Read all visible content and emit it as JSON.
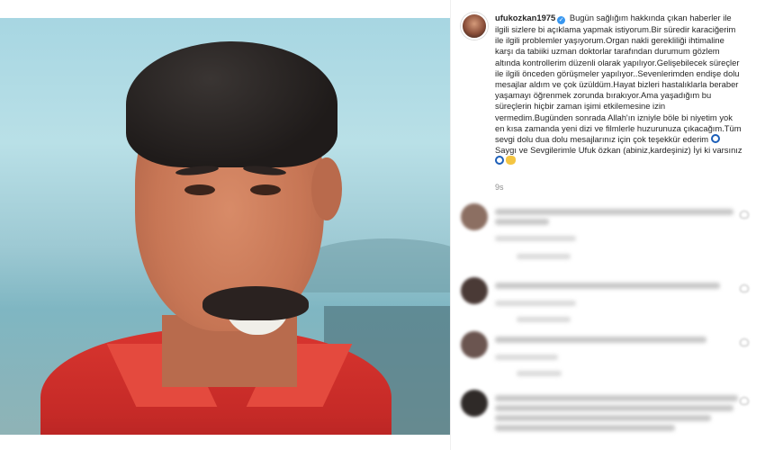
{
  "post": {
    "username": "ufukozkan1975",
    "caption_body": " Bugün sağlığım hakkında çıkan haberler ile\nilgili sizlere bi açıklama yapmak istiyorum.Bir süredir karaciğerim\nile ilgili problemler yaşıyorum.Organ nakli gerekliliği ihtimaline\nkarşı da tabiiki uzman doktorlar tarafından durumum gözlem\naltında kontrollerim düzenli olarak yapılıyor.Gelişebilecek süreçler\nile ilgili önceden görüşmeler yapılıyor..Sevenlerimden endişe dolu\nmesajlar aldım ve çok üzüldüm.Hayat bizleri hastalıklarla beraber\nyaşamayı öğrenmek zorunda bırakıyor.Ama yaşadığım bu\nsüreçlerin hiçbir zaman işimi etkilemesine izin\nvermedim.Bugünden sonrada Allah'ın izniyle böle bi niyetim yok\nen kısa zamanda yeni dizi ve filmlerle huzurunuza çıkacağım.Tüm\nsevgi dolu dua dolu mesajlarınız için çok teşekkür ederim",
    "caption_signoff": "Saygı ve Sevgilerimle Ufuk özkan (abiniz,kardeşiniz) İyi ki varsınız",
    "time_ago": "9s",
    "emoji_icons": [
      "blue-eye-icon",
      "raised-hands-icon"
    ]
  },
  "comments_note": "blurred comment rows, no legible text",
  "colors": {
    "verified": "#3897f0",
    "username": "#262626",
    "muted": "#8e8e8e",
    "shirt": "#c52a27"
  }
}
